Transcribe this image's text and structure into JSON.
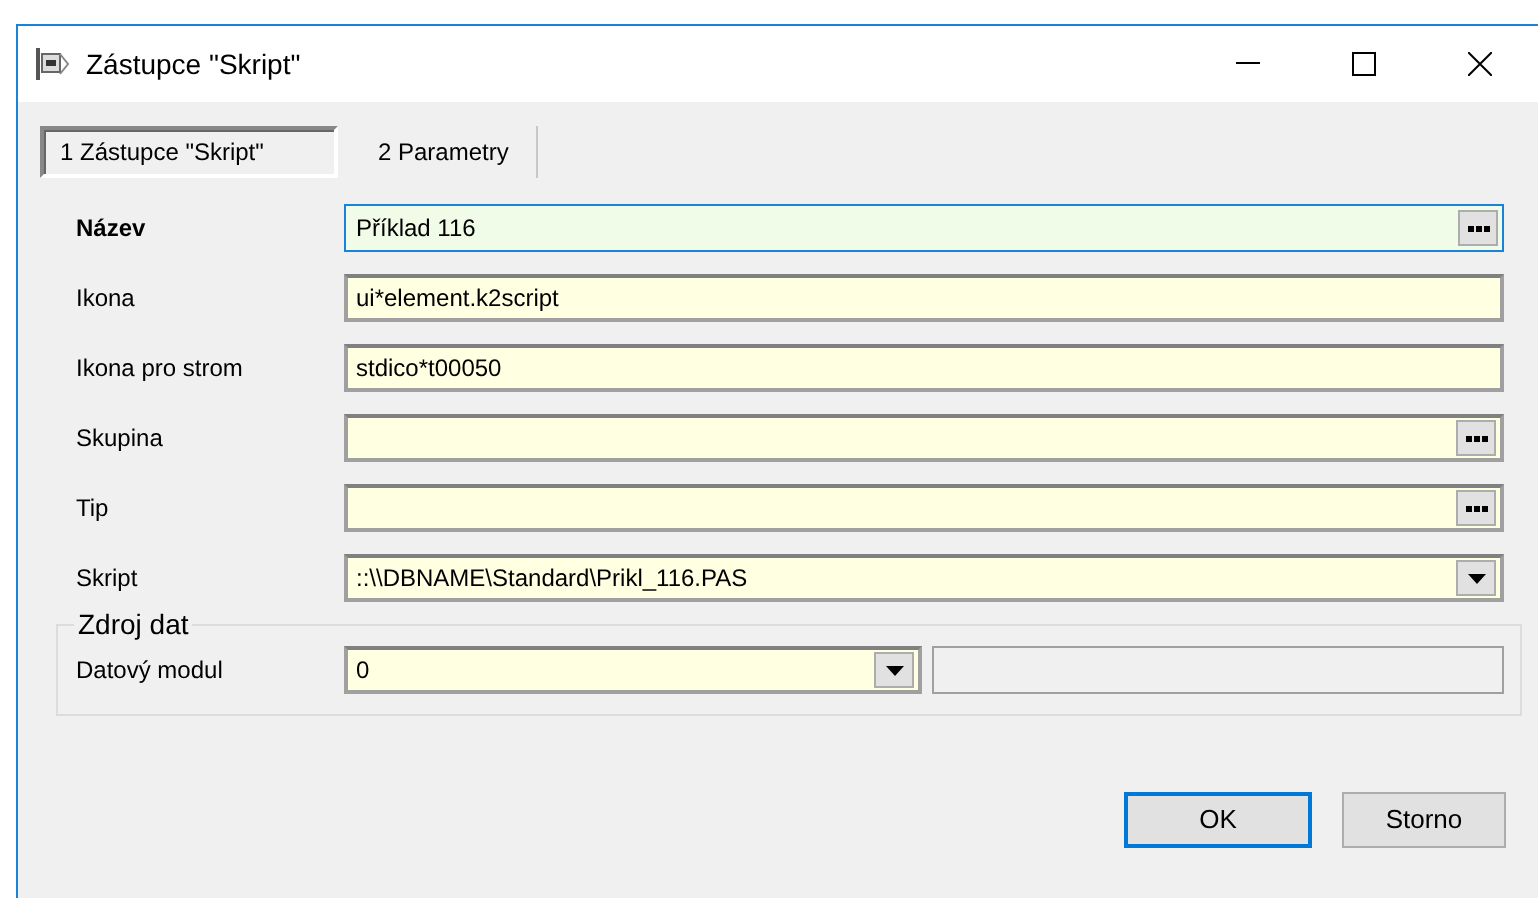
{
  "window": {
    "title": "Zástupce \"Skript\""
  },
  "tabs": [
    {
      "label": "1 Zástupce \"Skript\"",
      "selected": true
    },
    {
      "label": "2 Parametry",
      "selected": false
    }
  ],
  "fields": [
    {
      "label": "Název",
      "value": "Příklad 116",
      "kind": "lookup",
      "focused": true,
      "bold": true
    },
    {
      "label": "Ikona",
      "value": "ui*element.k2script",
      "kind": "text",
      "focused": false,
      "bold": false
    },
    {
      "label": "Ikona pro strom",
      "value": "stdico*t00050",
      "kind": "text",
      "focused": false,
      "bold": false
    },
    {
      "label": "Skupina",
      "kind": "lookup",
      "focused": false,
      "bold": false
    },
    {
      "label": "Tip",
      "kind": "lookup",
      "focused": false,
      "bold": false
    },
    {
      "label": "Skript",
      "value": "::\\\\DBNAME\\Standard\\Prikl_116.PAS",
      "kind": "combo",
      "focused": false,
      "bold": false
    }
  ],
  "data_source": {
    "title": "Zdroj dat",
    "label": "Datový modul",
    "value": "0"
  },
  "buttons": [
    {
      "label": "OK",
      "default": true
    },
    {
      "label": "Storno",
      "default": false
    }
  ]
}
